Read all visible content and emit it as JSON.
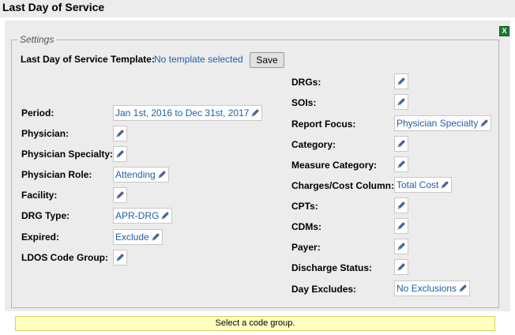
{
  "page_title": "Last Day of Service",
  "settings_legend": "Settings",
  "template": {
    "label": "Last Day of Service Template:",
    "value": "No template selected",
    "save_label": "Save"
  },
  "left_fields": {
    "period": {
      "label": "Period:",
      "value": "Jan 1st, 2016 to Dec 31st, 2017"
    },
    "physician": {
      "label": "Physician:",
      "value": ""
    },
    "physician_specialty": {
      "label": "Physician Specialty:",
      "value": ""
    },
    "physician_role": {
      "label": "Physician Role:",
      "value": "Attending"
    },
    "facility": {
      "label": "Facility:",
      "value": ""
    },
    "drg_type": {
      "label": "DRG Type:",
      "value": "APR-DRG"
    },
    "expired": {
      "label": "Expired:",
      "value": "Exclude"
    },
    "ldos_code_group": {
      "label": "LDOS Code Group:",
      "value": ""
    }
  },
  "right_fields": {
    "drgs": {
      "label": "DRGs:",
      "value": ""
    },
    "sois": {
      "label": "SOIs:",
      "value": ""
    },
    "report_focus": {
      "label": "Report Focus:",
      "value": "Physician Specialty"
    },
    "category": {
      "label": "Category:",
      "value": ""
    },
    "measure_category": {
      "label": "Measure Category:",
      "value": ""
    },
    "charges_cost_column": {
      "label": "Charges/Cost Column:",
      "value": "Total Cost"
    },
    "cpts": {
      "label": "CPTs:",
      "value": ""
    },
    "cdms": {
      "label": "CDMs:",
      "value": ""
    },
    "payer": {
      "label": "Payer:",
      "value": ""
    },
    "discharge_status": {
      "label": "Discharge Status:",
      "value": ""
    },
    "day_excludes": {
      "label": "Day Excludes:",
      "value": "No Exclusions"
    }
  },
  "status_message": "Select a code group.",
  "icons": {
    "edit": "pencil-icon",
    "export": "excel-export-icon"
  },
  "colors": {
    "link": "#1f5fa8",
    "panel": "#ececec",
    "status_bg": "#ffffc0"
  }
}
